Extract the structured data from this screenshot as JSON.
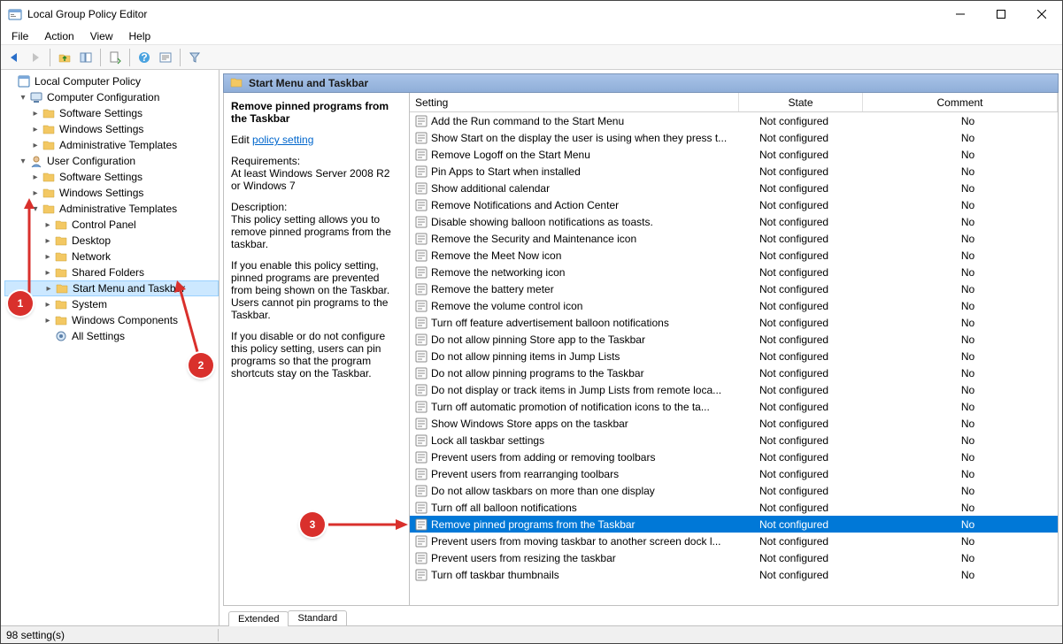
{
  "window": {
    "title": "Local Group Policy Editor"
  },
  "menubar": [
    "File",
    "Action",
    "View",
    "Help"
  ],
  "tree": {
    "root": "Local Computer Policy",
    "computer_cfg": "Computer Configuration",
    "cc_children": [
      "Software Settings",
      "Windows Settings",
      "Administrative Templates"
    ],
    "user_cfg": "User Configuration",
    "uc_children": [
      "Software Settings",
      "Windows Settings",
      "Administrative Templates"
    ],
    "at_children": [
      "Control Panel",
      "Desktop",
      "Network",
      "Shared Folders",
      "Start Menu and Taskbar",
      "System",
      "Windows Components",
      "All Settings"
    ],
    "selected": "Start Menu and Taskbar"
  },
  "header": "Start Menu and Taskbar",
  "desc": {
    "title": "Remove pinned programs from the Taskbar",
    "edit_prefix": "Edit ",
    "edit_link": "policy setting ",
    "req_label": "Requirements:",
    "req_text": "At least Windows Server 2008 R2 or Windows 7",
    "desc_label": "Description:",
    "desc_text": "This policy setting allows you to remove pinned programs from the taskbar.",
    "p1": "If you enable this policy setting, pinned programs are prevented from being shown on the Taskbar. Users cannot pin programs to the Taskbar.",
    "p2": "If you disable or do not configure this policy setting, users can pin programs so that the program shortcuts stay on the Taskbar."
  },
  "columns": {
    "setting": "Setting",
    "state": "State",
    "comment": "Comment"
  },
  "rows": [
    {
      "s": "Add the Run command to the Start Menu",
      "st": "Not configured",
      "c": "No"
    },
    {
      "s": "Show Start on the display the user is using when they press t...",
      "st": "Not configured",
      "c": "No"
    },
    {
      "s": "Remove Logoff on the Start Menu",
      "st": "Not configured",
      "c": "No"
    },
    {
      "s": "Pin Apps to Start when installed",
      "st": "Not configured",
      "c": "No"
    },
    {
      "s": "Show additional calendar",
      "st": "Not configured",
      "c": "No"
    },
    {
      "s": "Remove Notifications and Action Center",
      "st": "Not configured",
      "c": "No"
    },
    {
      "s": "Disable showing balloon notifications as toasts.",
      "st": "Not configured",
      "c": "No"
    },
    {
      "s": "Remove the Security and Maintenance icon",
      "st": "Not configured",
      "c": "No"
    },
    {
      "s": "Remove the Meet Now icon",
      "st": "Not configured",
      "c": "No"
    },
    {
      "s": "Remove the networking icon",
      "st": "Not configured",
      "c": "No"
    },
    {
      "s": "Remove the battery meter",
      "st": "Not configured",
      "c": "No"
    },
    {
      "s": "Remove the volume control icon",
      "st": "Not configured",
      "c": "No"
    },
    {
      "s": "Turn off feature advertisement balloon notifications",
      "st": "Not configured",
      "c": "No"
    },
    {
      "s": "Do not allow pinning Store app to the Taskbar",
      "st": "Not configured",
      "c": "No"
    },
    {
      "s": "Do not allow pinning items in Jump Lists",
      "st": "Not configured",
      "c": "No"
    },
    {
      "s": "Do not allow pinning programs to the Taskbar",
      "st": "Not configured",
      "c": "No"
    },
    {
      "s": "Do not display or track items in Jump Lists from remote loca...",
      "st": "Not configured",
      "c": "No"
    },
    {
      "s": "Turn off automatic promotion of notification icons to the ta...",
      "st": "Not configured",
      "c": "No"
    },
    {
      "s": "Show Windows Store apps on the taskbar",
      "st": "Not configured",
      "c": "No"
    },
    {
      "s": "Lock all taskbar settings",
      "st": "Not configured",
      "c": "No"
    },
    {
      "s": "Prevent users from adding or removing toolbars",
      "st": "Not configured",
      "c": "No"
    },
    {
      "s": "Prevent users from rearranging toolbars",
      "st": "Not configured",
      "c": "No"
    },
    {
      "s": "Do not allow taskbars on more than one display",
      "st": "Not configured",
      "c": "No"
    },
    {
      "s": "Turn off all balloon notifications",
      "st": "Not configured",
      "c": "No"
    },
    {
      "s": "Remove pinned programs from the Taskbar",
      "st": "Not configured",
      "c": "No",
      "sel": true
    },
    {
      "s": "Prevent users from moving taskbar to another screen dock l...",
      "st": "Not configured",
      "c": "No"
    },
    {
      "s": "Prevent users from resizing the taskbar",
      "st": "Not configured",
      "c": "No"
    },
    {
      "s": "Turn off taskbar thumbnails",
      "st": "Not configured",
      "c": "No"
    }
  ],
  "tabs": {
    "extended": "Extended",
    "standard": "Standard"
  },
  "status": "98 setting(s)",
  "annotations": {
    "one": "1",
    "two": "2",
    "three": "3"
  }
}
